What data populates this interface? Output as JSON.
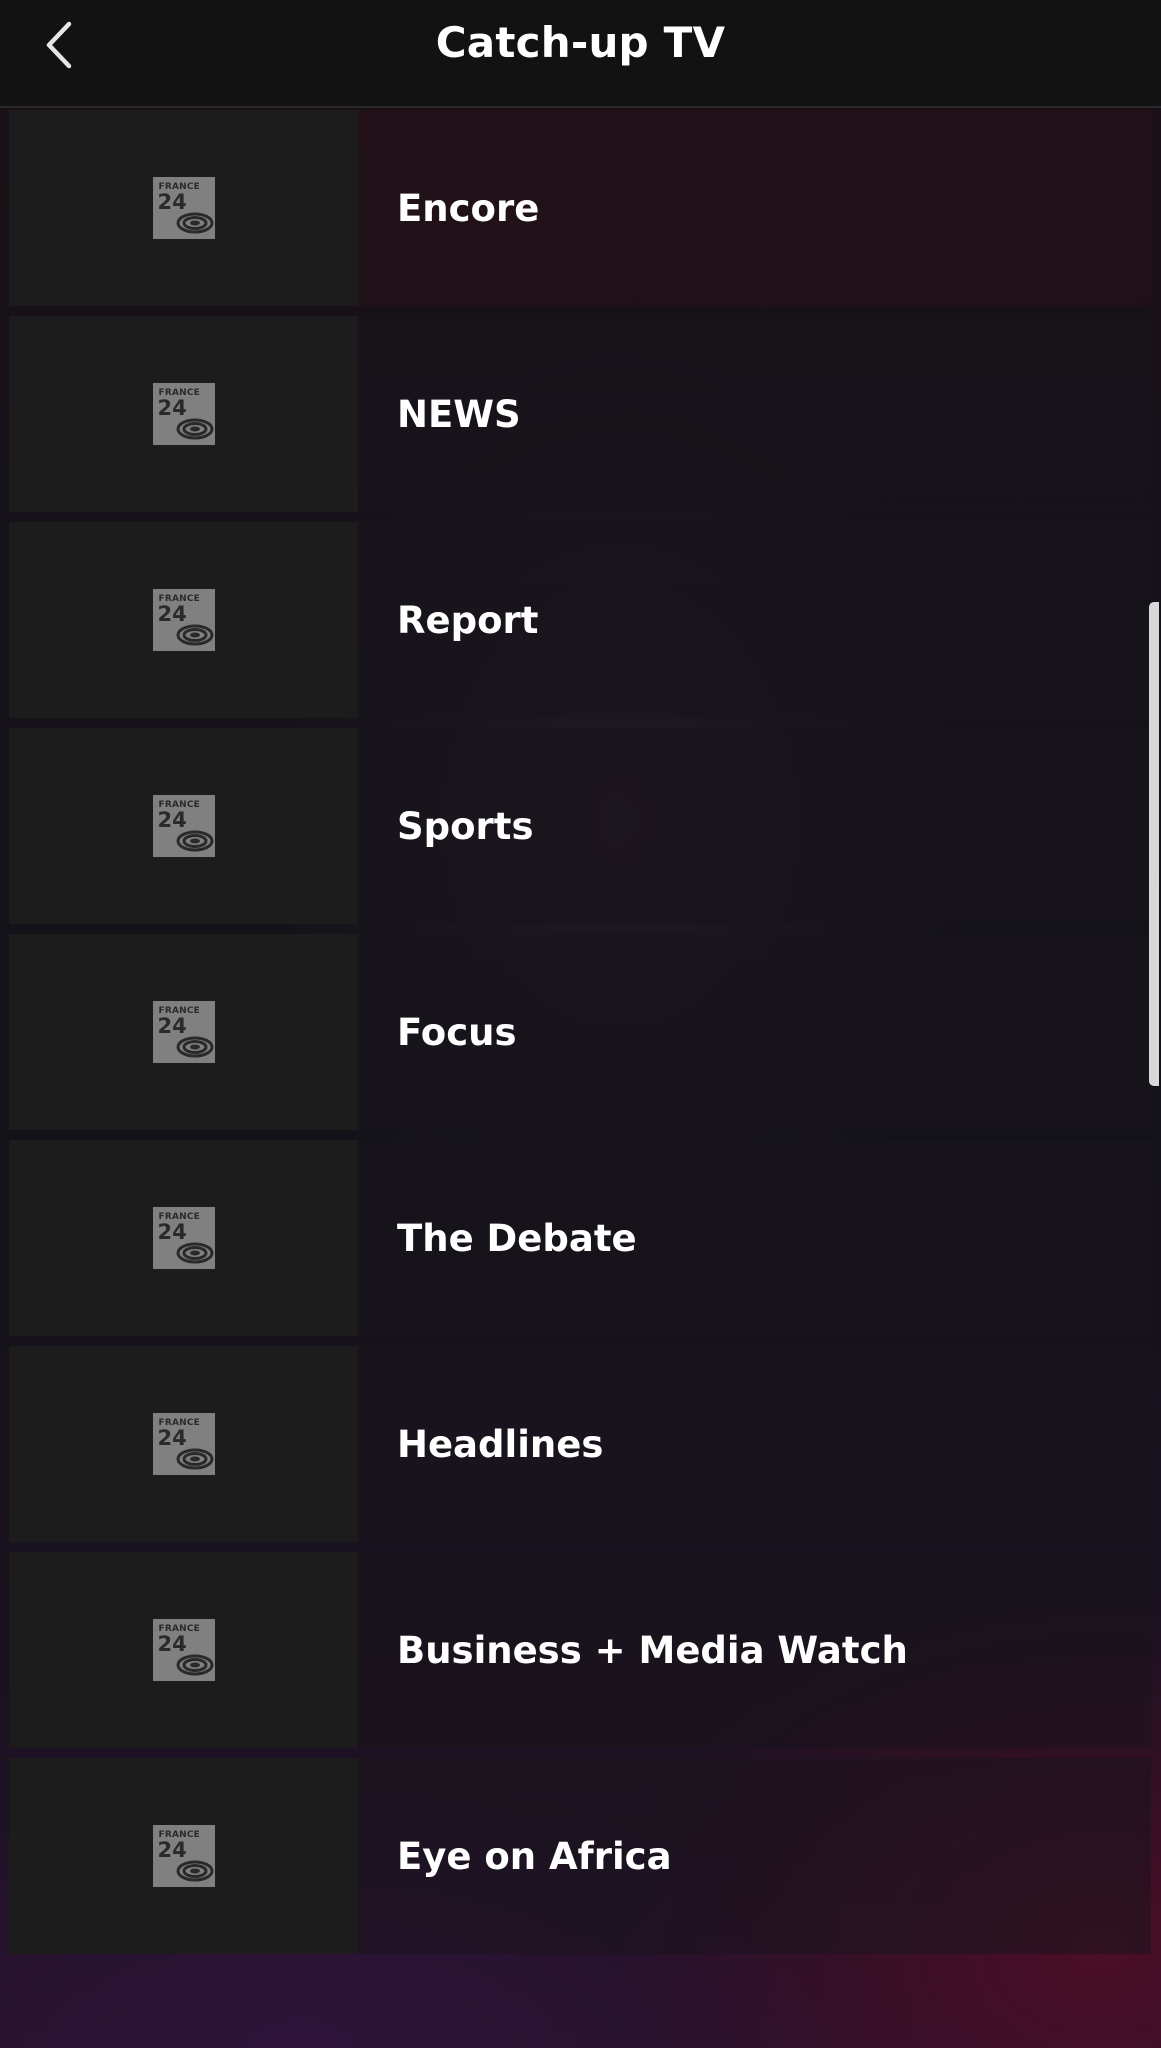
{
  "header": {
    "title": "Catch-up TV",
    "back_icon": "chevron-left-icon"
  },
  "logo": {
    "line1": "FRANCE",
    "line2": "24"
  },
  "items": [
    {
      "label": "Encore"
    },
    {
      "label": "NEWS"
    },
    {
      "label": "Report"
    },
    {
      "label": "Sports"
    },
    {
      "label": "Focus"
    },
    {
      "label": "The Debate"
    },
    {
      "label": "Headlines"
    },
    {
      "label": "Business + Media Watch"
    },
    {
      "label": "Eye on Africa"
    }
  ],
  "colors": {
    "header_bg": "#121212",
    "thumb_bg": "#1c1c1c",
    "logo_bg": "#808080",
    "accent_bottom": "#6e0a23"
  }
}
